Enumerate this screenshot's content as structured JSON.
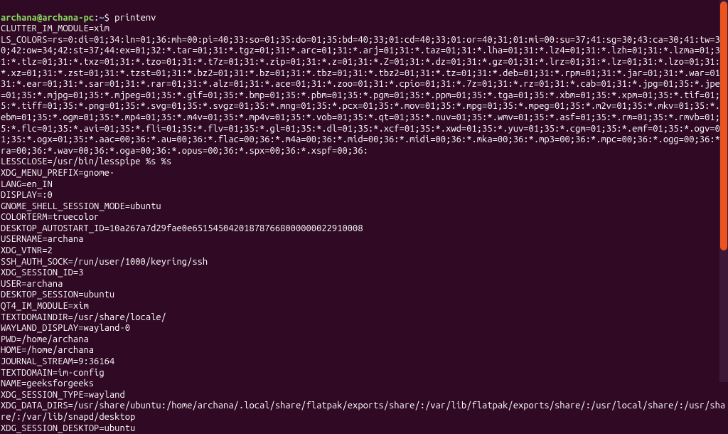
{
  "prompt": {
    "user_host": "archana@archana-pc",
    "path": "~",
    "symbol": "$",
    "command": "printenv"
  },
  "output": [
    "CLUTTER_IM_MODULE=xim",
    "LS_COLORS=rs=0:di=01;34:ln=01;36:mh=00:pi=40;33:so=01;35:do=01;35:bd=40;33;01:cd=40;33;01:or=40;31;01:mi=00:su=37;41:sg=30;43:ca=30;41:tw=30;42:ow=34;42:st=37;44:ex=01;32:*.tar=01;31:*.tgz=01;31:*.arc=01;31:*.arj=01;31:*.taz=01;31:*.lha=01;31:*.lz4=01;31:*.lzh=01;31:*.lzma=01;31:*.tlz=01;31:*.txz=01;31:*.tzo=01;31:*.t7z=01;31:*.zip=01;31:*.z=01;31:*.Z=01;31:*.dz=01;31:*.gz=01;31:*.lrz=01;31:*.lz=01;31:*.lzo=01;31:*.xz=01;31:*.zst=01;31:*.tzst=01;31:*.bz2=01;31:*.bz=01;31:*.tbz=01;31:*.tbz2=01;31:*.tz=01;31:*.deb=01;31:*.rpm=01;31:*.jar=01;31:*.war=01;31:*.ear=01;31:*.sar=01;31:*.rar=01;31:*.alz=01;31:*.ace=01;31:*.zoo=01;31:*.cpio=01;31:*.7z=01;31:*.rz=01;31:*.cab=01;31:*.jpg=01;35:*.jpeg=01;35:*.mjpg=01;35:*.mjpeg=01;35:*.gif=01;35:*.bmp=01;35:*.pbm=01;35:*.pgm=01;35:*.ppm=01;35:*.tga=01;35:*.xbm=01;35:*.xpm=01;35:*.tif=01;35:*.tiff=01;35:*.png=01;35:*.svg=01;35:*.svgz=01;35:*.mng=01;35:*.pcx=01;35:*.mov=01;35:*.mpg=01;35:*.mpeg=01;35:*.m2v=01;35:*.mkv=01;35:*.webm=01;35:*.ogm=01;35:*.mp4=01;35:*.m4v=01;35:*.mp4v=01;35:*.vob=01;35:*.qt=01;35:*.nuv=01;35:*.wmv=01;35:*.asf=01;35:*.rm=01;35:*.rmvb=01;35:*.flc=01;35:*.avi=01;35:*.fli=01;35:*.flv=01;35:*.gl=01;35:*.dl=01;35:*.xcf=01;35:*.xwd=01;35:*.yuv=01;35:*.cgm=01;35:*.emf=01;35:*.ogv=01;35:*.ogx=01;35:*.aac=00;36:*.au=00;36:*.flac=00;36:*.m4a=00;36:*.mid=00;36:*.midi=00;36:*.mka=00;36:*.mp3=00;36:*.mpc=00;36:*.ogg=00;36:*.ra=00;36:*.wav=00;36:*.oga=00;36:*.opus=00;36:*.spx=00;36:*.xspf=00;36:",
    "LESSCLOSE=/usr/bin/lesspipe %s %s",
    "XDG_MENU_PREFIX=gnome-",
    "LANG=en_IN",
    "DISPLAY=:0",
    "GNOME_SHELL_SESSION_MODE=ubuntu",
    "COLORTERM=truecolor",
    "DESKTOP_AUTOSTART_ID=10a267a7d29fae0e651545042018787668000000022910008",
    "USERNAME=archana",
    "XDG_VTNR=2",
    "SSH_AUTH_SOCK=/run/user/1000/keyring/ssh",
    "XDG_SESSION_ID=3",
    "USER=archana",
    "DESKTOP_SESSION=ubuntu",
    "QT4_IM_MODULE=xim",
    "TEXTDOMAINDIR=/usr/share/locale/",
    "WAYLAND_DISPLAY=wayland-0",
    "PWD=/home/archana",
    "HOME=/home/archana",
    "JOURNAL_STREAM=9:36164",
    "TEXTDOMAIN=im-config",
    "NAME=geeksforgeeks",
    "XDG_SESSION_TYPE=wayland",
    "XDG_DATA_DIRS=/usr/share/ubuntu:/home/archana/.local/share/flatpak/exports/share/:/var/lib/flatpak/exports/share/:/usr/local/share/:/usr/share/:/var/lib/snapd/desktop",
    "XDG_SESSION_DESKTOP=ubuntu"
  ]
}
